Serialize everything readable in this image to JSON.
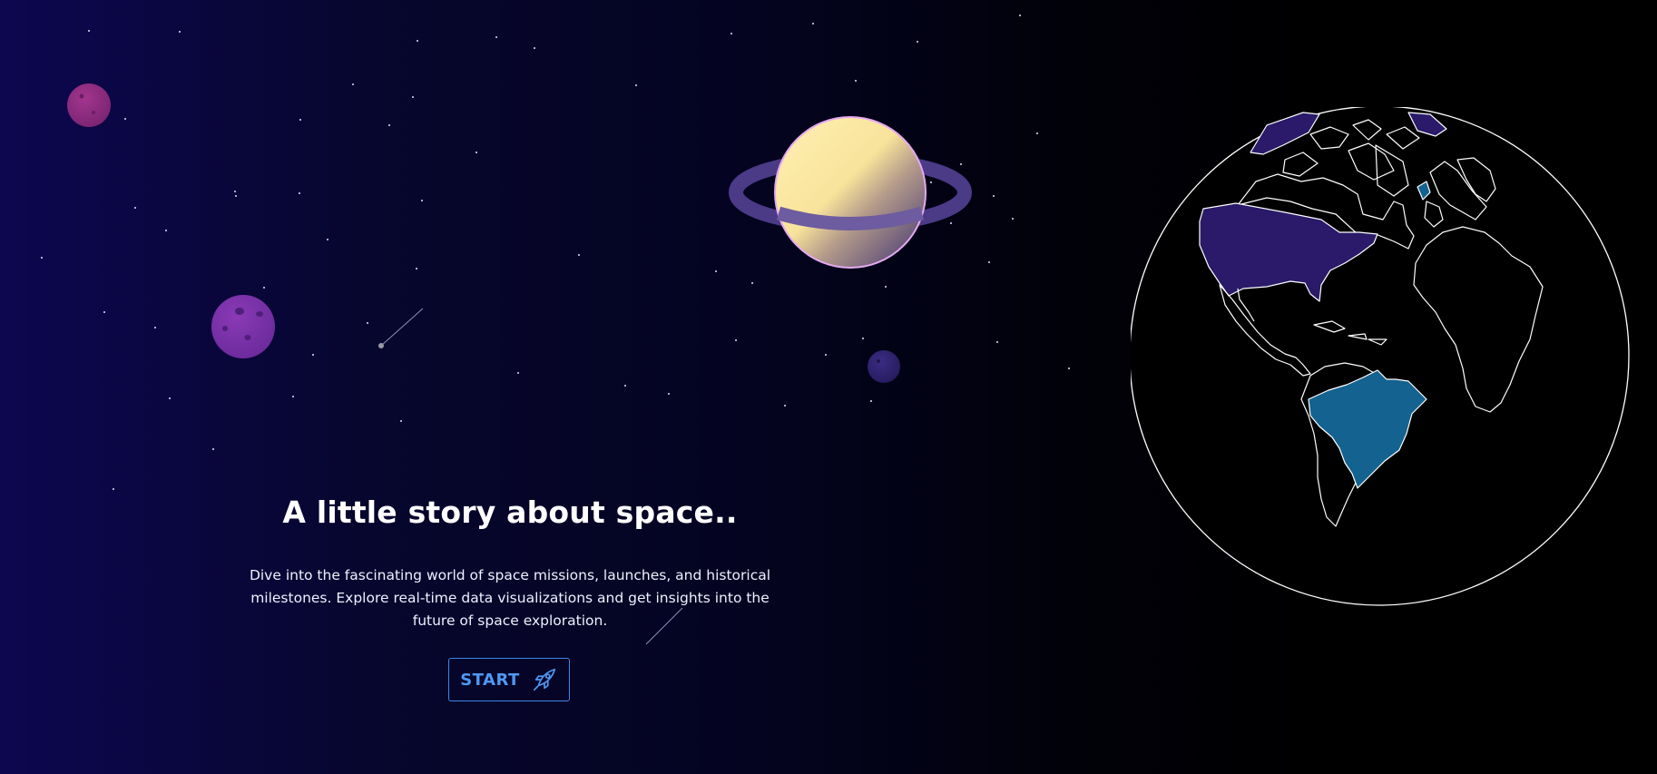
{
  "hero": {
    "title": "A little story about space..",
    "description": "Dive into the fascinating world of space missions, launches, and historical milestones. Explore real-time data visualizations and get insights into the future of space exploration.",
    "start_label": "START"
  },
  "icons": {
    "start_button_icon": "rocket-icon"
  },
  "globe": {
    "highlighted_regions": [
      "United States",
      "Brazil",
      "Greenland",
      "Iceland",
      "United Kingdom"
    ]
  },
  "colors": {
    "background_left": "#0d0750",
    "background_right": "#000000",
    "accent_button": "#3a86e6",
    "highlight_purple": "#2b1b6b",
    "highlight_blue": "#14628f",
    "planet_magenta": "#8e2d7e",
    "saturn_yellow": "#fbe8a2",
    "ring_purple": "#4b3a86"
  }
}
